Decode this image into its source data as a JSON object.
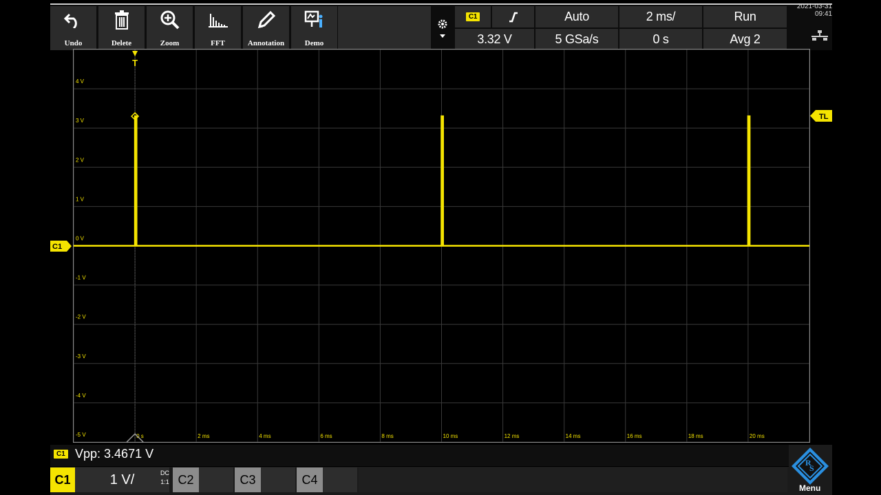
{
  "toolbar": {
    "tools": [
      {
        "label": "Undo",
        "icon": "undo-icon"
      },
      {
        "label": "Delete",
        "icon": "trash-icon"
      },
      {
        "label": "Zoom",
        "icon": "zoom-icon"
      },
      {
        "label": "FFT",
        "icon": "fft-icon"
      },
      {
        "label": "Annotation",
        "icon": "pencil-icon"
      },
      {
        "label": "Demo",
        "icon": "demo-icon"
      }
    ]
  },
  "trigger": {
    "source": "C1",
    "edge_icon": "rising-edge-icon",
    "mode": "Auto",
    "level": "3.32 V"
  },
  "acquisition": {
    "timebase": "2 ms/",
    "sample_rate": "5 GSa/s",
    "position": "0 s",
    "run_state": "Run",
    "averaging": "Avg 2"
  },
  "datetime": {
    "date": "2021-03-31",
    "time": "09:41"
  },
  "grid": {
    "y_labels": [
      "4 V",
      "3 V",
      "2 V",
      "1 V",
      "0 V",
      "-1 V",
      "-2 V",
      "-3 V",
      "-4 V",
      "-5 V"
    ],
    "x_labels": [
      "0 s",
      "2 ms",
      "4 ms",
      "6 ms",
      "8 ms",
      "10 ms",
      "12 ms",
      "14 ms",
      "16 ms",
      "18 ms",
      "20 ms"
    ],
    "trigger_marker": "T",
    "trigger_level_marker": "TL",
    "channel_marker": "C1"
  },
  "waveform": {
    "channel": "C1",
    "color": "#f5e400",
    "baseline_v": 0,
    "pulse_high_v": 3.3,
    "pulse_times_ms": [
      0,
      10,
      20
    ],
    "pulse_width_ms": 0.05,
    "x_range_ms": [
      -2,
      22
    ],
    "y_range_v": [
      -5,
      5
    ]
  },
  "measurement": {
    "channel": "C1",
    "text": "Vpp: 3.4671 V"
  },
  "channels": {
    "c1_label": "C1",
    "c1_scale": "1 V/",
    "c1_coupling": "DC",
    "c1_impedance": "1:1",
    "c2_label": "C2",
    "c3_label": "C3",
    "c4_label": "C4"
  },
  "menu_label": "Menu"
}
